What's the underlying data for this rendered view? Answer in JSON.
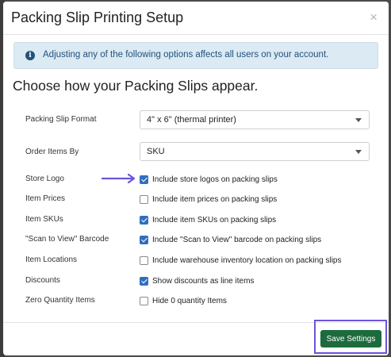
{
  "modal": {
    "title": "Packing Slip Printing Setup",
    "close_glyph": "×",
    "info_message": "Adjusting any of the following options affects all users on your account.",
    "info_icon_glyph": "i",
    "section_heading": "Choose how your Packing Slips appear."
  },
  "fields": {
    "format": {
      "label": "Packing Slip Format",
      "value": "4\" x 6\" (thermal printer)"
    },
    "order_by": {
      "label": "Order Items By",
      "value": "SKU"
    }
  },
  "options": [
    {
      "label": "Store Logo",
      "checkbox_label": "Include store logos on packing slips",
      "checked": true
    },
    {
      "label": "Item Prices",
      "checkbox_label": "Include item prices on packing slips",
      "checked": false
    },
    {
      "label": "Item SKUs",
      "checkbox_label": "Include item SKUs on packing slips",
      "checked": true
    },
    {
      "label": "\"Scan to View\" Barcode",
      "checkbox_label": "Include \"Scan to View\" barcode on packing slips",
      "checked": true
    },
    {
      "label": "Item Locations",
      "checkbox_label": "Include warehouse inventory location on packing slips",
      "checked": false
    },
    {
      "label": "Discounts",
      "checkbox_label": "Show discounts as line items",
      "checked": true
    },
    {
      "label": "Zero Quantity Items",
      "checkbox_label": "Hide 0 quantity Items",
      "checked": false
    }
  ],
  "footer": {
    "save_label": "Save Settings"
  },
  "colors": {
    "checkbox_checked": "#2f6fbf",
    "save_button": "#1d6b3d",
    "info_background": "#dbeaf3",
    "info_text": "#23517c",
    "annotation": "#6a55d8"
  },
  "icons": {
    "info": "info-circle-icon",
    "close": "close-icon",
    "dropdown": "chevron-down-icon",
    "annotation_arrow": "arrow-right-icon"
  }
}
